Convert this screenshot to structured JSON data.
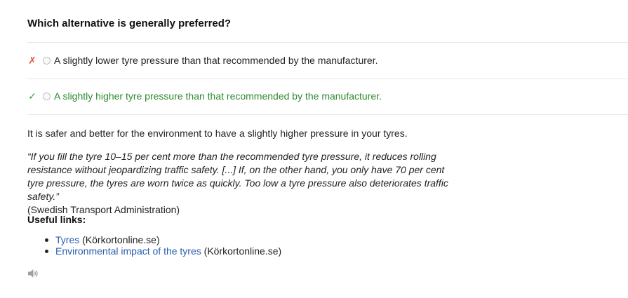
{
  "question": "Which alternative is generally preferred?",
  "answers": [
    {
      "mark": "✗",
      "mark_icon": "cross-icon",
      "text": "A slightly lower tyre pressure than that recommended by the manufacturer.",
      "status": "incorrect"
    },
    {
      "mark": "✓",
      "mark_icon": "check-icon",
      "text": "A slightly higher tyre pressure than that recommended by the manufacturer.",
      "status": "correct"
    }
  ],
  "explanation": "It is safer and better for the environment to have a slightly higher pressure in your tyres.",
  "quote": {
    "text": "“If you fill the tyre 10–15 per cent more than the recommended tyre pressure, it reduces rolling resistance without jeopardizing traffic safety. [...] If, on the other hand, you only have 70 per cent tyre pressure, the tyres are worn twice as quickly. Too low a tyre pressure also deteriorates traffic safety.”",
    "source": "(Swedish Transport Administration)"
  },
  "links_heading": "Useful links:",
  "links": [
    {
      "label": "Tyres",
      "suffix": " (Körkortonline.se)"
    },
    {
      "label": "Environmental impact of the tyres",
      "suffix": " (Körkortonline.se)"
    }
  ],
  "audio": {
    "icon": "speaker-icon"
  },
  "colors": {
    "wrong_mark": "#e05656",
    "correct_mark": "#3aa03a",
    "correct_text": "#2f8a2f",
    "link": "#2a5db0"
  }
}
